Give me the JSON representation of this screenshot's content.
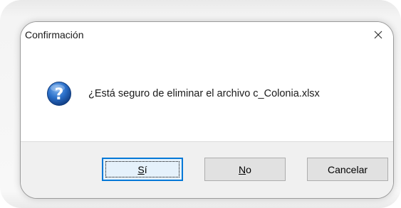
{
  "dialog": {
    "title": "Confirmación",
    "close_symbol": "✕",
    "message": "¿Está seguro de eliminar el archivo c_Colonia.xlsx",
    "icon": "question-icon"
  },
  "buttons": {
    "yes": {
      "accel": "S",
      "rest": "í"
    },
    "no": {
      "accel": "N",
      "rest": "o"
    },
    "cancel": {
      "label": "Cancelar"
    }
  },
  "colors": {
    "icon_blue": "#2a6fc9",
    "default_button_border": "#0078d7",
    "footer_bg": "#f0f0f0"
  }
}
